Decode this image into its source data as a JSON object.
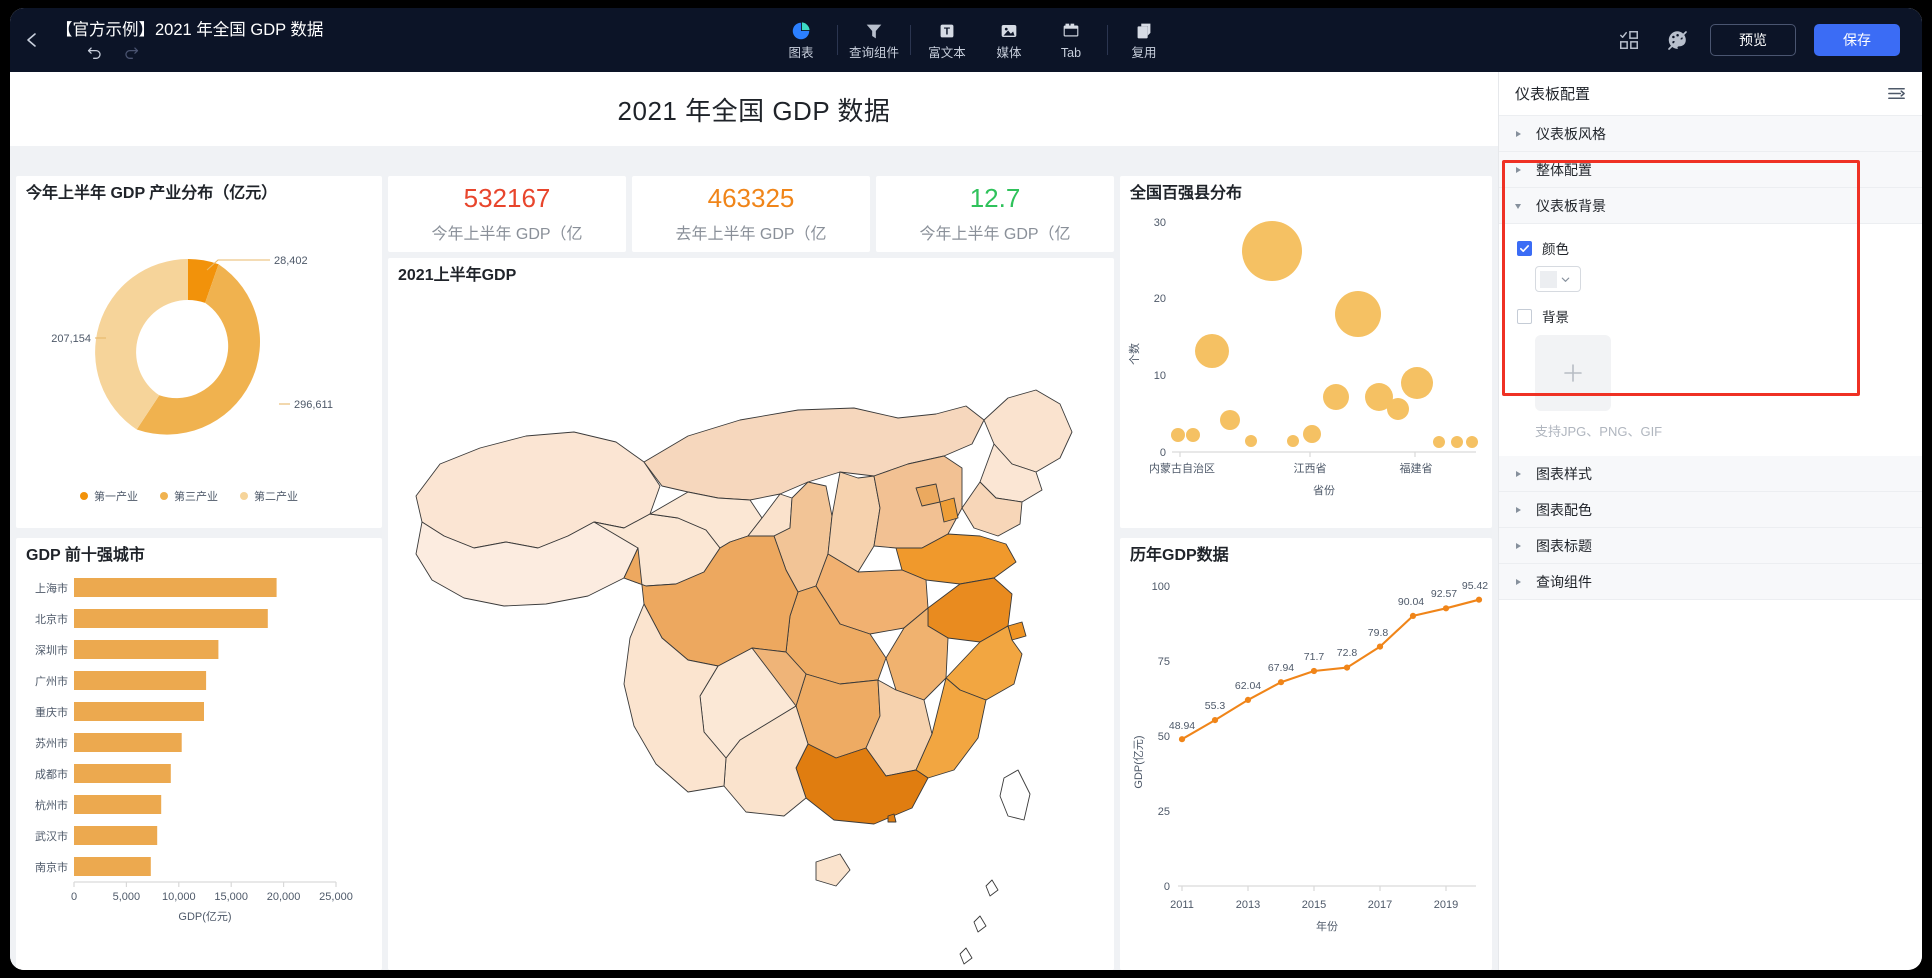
{
  "header": {
    "doc_title": "【官方示例】2021 年全国 GDP 数据",
    "back_icon": "chevron-left-icon",
    "undo_icon": "undo-icon",
    "redo_icon": "redo-icon",
    "tools": [
      {
        "label": "图表",
        "icon": "pie-chart-icon"
      },
      {
        "label": "查询组件",
        "icon": "filter-icon"
      },
      {
        "label": "富文本",
        "icon": "rich-text-icon"
      },
      {
        "label": "媒体",
        "icon": "media-image-icon"
      },
      {
        "label": "Tab",
        "icon": "tab-icon"
      },
      {
        "label": "复用",
        "icon": "copy-icon"
      }
    ],
    "grid_icon": "layout-grid-icon",
    "theme_icon": "palette-icon",
    "preview_label": "预览",
    "save_label": "保存",
    "accent_color": "#3b6cf5"
  },
  "dashboard": {
    "title": "2021 年全国 GDP 数据"
  },
  "kpis": [
    {
      "value": "532167",
      "label": "今年上半年 GDP（亿",
      "color": "#e8452c"
    },
    {
      "value": "463325",
      "label": "去年上半年 GDP（亿",
      "color": "#f08519"
    },
    {
      "value": "12.7",
      "label": "今年上半年 GDP（亿",
      "color": "#2fc25b"
    }
  ],
  "map_card": {
    "title": "2021上半年GDP"
  },
  "panel": {
    "title": "仪表板配置",
    "menu_icon": "list-settings-icon",
    "sections_before": [
      {
        "label": "仪表板风格",
        "expanded": false
      },
      {
        "label": "整体配置",
        "expanded": false
      }
    ],
    "background_section": {
      "label": "仪表板背景",
      "expanded": true,
      "highlight_color": "#ef3124",
      "color_option": {
        "label": "颜色",
        "checked": true,
        "swatch": "#eceef1"
      },
      "image_option": {
        "label": "背景",
        "checked": false,
        "plus_icon": "plus-icon"
      },
      "upload_hint": "支持JPG、PNG、GIF"
    },
    "sections_after": [
      {
        "label": "图表样式",
        "expanded": false
      },
      {
        "label": "图表配色",
        "expanded": false
      },
      {
        "label": "图表标题",
        "expanded": false
      },
      {
        "label": "查询组件",
        "expanded": false
      }
    ]
  },
  "chart_data": [
    {
      "id": "donut",
      "type": "pie",
      "title": "今年上半年 GDP 产业分布（亿元）",
      "categories": [
        "第一产业",
        "第三产业",
        "第二产业"
      ],
      "values": [
        28402,
        296611,
        207154
      ],
      "labels": [
        "28,402",
        "296,611",
        "207,154"
      ],
      "colors": [
        "#f2920a",
        "#f0b24f",
        "#f6d49a"
      ],
      "legend": [
        "第一产业",
        "第三产业",
        "第二产业"
      ],
      "legend_position": "bottom",
      "donut": true
    },
    {
      "id": "top10-cities",
      "type": "bar",
      "orientation": "horizontal",
      "title": "GDP 前十强城市",
      "categories": [
        "上海市",
        "北京市",
        "深圳市",
        "广州市",
        "重庆市",
        "苏州市",
        "成都市",
        "杭州市",
        "武汉市",
        "南京市"
      ],
      "values": [
        20102,
        19228,
        14324,
        13101,
        12900,
        10685,
        9603,
        8646,
        8251,
        7622
      ],
      "xlabel": "GDP(亿元)",
      "ylabel": "",
      "xticks": [
        "0",
        "5,000",
        "10,000",
        "15,000",
        "20,000",
        "25,000"
      ],
      "xlim": [
        0,
        25000
      ],
      "color": "#eca94f",
      "grid": false
    },
    {
      "id": "top100-counties",
      "type": "scatter",
      "title": "全国百强县分布",
      "xlabel": "省份",
      "ylabel": "个数",
      "xticks": [
        "内蒙古自治区",
        "江西省",
        "福建省"
      ],
      "yticks": [
        "0",
        "10",
        "20",
        "30"
      ],
      "ylim": [
        0,
        30
      ],
      "color": "#f5c163",
      "points": [
        {
          "x": 0.02,
          "y": 2.2,
          "r": 7
        },
        {
          "x": 0.07,
          "y": 2.2,
          "r": 7
        },
        {
          "x": 0.13,
          "y": 13.2,
          "r": 17
        },
        {
          "x": 0.19,
          "y": 4.2,
          "r": 10
        },
        {
          "x": 0.26,
          "y": 1.5,
          "r": 6
        },
        {
          "x": 0.33,
          "y": 26.2,
          "r": 30
        },
        {
          "x": 0.4,
          "y": 1.5,
          "r": 6
        },
        {
          "x": 0.46,
          "y": 2.3,
          "r": 9
        },
        {
          "x": 0.54,
          "y": 7.2,
          "r": 13
        },
        {
          "x": 0.61,
          "y": 18.0,
          "r": 23
        },
        {
          "x": 0.67,
          "y": 7.2,
          "r": 14
        },
        {
          "x": 0.73,
          "y": 5.6,
          "r": 11
        },
        {
          "x": 0.79,
          "y": 9.1,
          "r": 16
        },
        {
          "x": 0.87,
          "y": 1.4,
          "r": 6
        },
        {
          "x": 0.93,
          "y": 1.4,
          "r": 6
        },
        {
          "x": 0.98,
          "y": 1.4,
          "r": 6
        }
      ]
    },
    {
      "id": "gdp-by-year",
      "type": "line",
      "title": "历年GDP数据",
      "xlabel": "年份",
      "ylabel": "GDP(亿元)",
      "x": [
        2011,
        2012,
        2013,
        2014,
        2015,
        2016,
        2017,
        2018,
        2019,
        2020
      ],
      "values": [
        48.94,
        55.3,
        62.04,
        67.94,
        71.7,
        72.8,
        79.8,
        90.04,
        92.57,
        95.42
      ],
      "point_labels": [
        "48.94",
        "55.3",
        "62.04",
        "67.94",
        "71.7",
        "72.8",
        "79.8",
        "90.04",
        "92.57",
        "95.42"
      ],
      "xticks": [
        "2011",
        "2013",
        "2015",
        "2017",
        "2019"
      ],
      "yticks": [
        "0",
        "25",
        "50",
        "75",
        "100"
      ],
      "ylim": [
        0,
        100
      ],
      "color": "#f08519"
    }
  ]
}
